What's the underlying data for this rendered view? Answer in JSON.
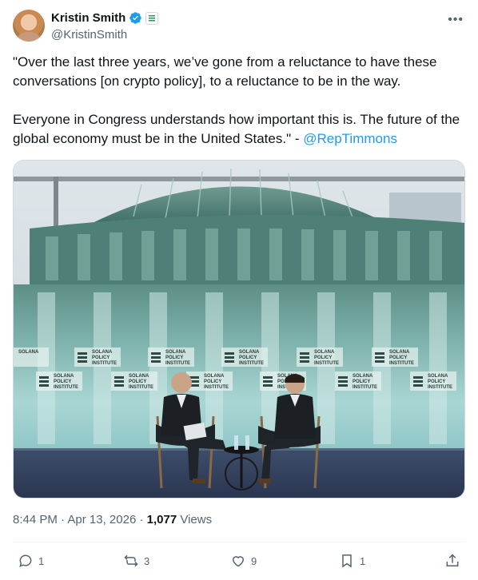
{
  "author": {
    "display_name": "Kristin Smith",
    "handle": "@KristinSmith"
  },
  "tweet": {
    "paragraph_1": "\"Over the last three years, we’ve gone from a reluctance to have these conversations [on crypto policy], to a reluctance to be in the way.",
    "paragraph_2_text": "Everyone in Congress understands how important this is. The future of the global economy must be in the United States.\" - ",
    "mention": "@RepTimmons"
  },
  "media": {
    "backdrop_label_line1": "SOLANA",
    "backdrop_label_line2": "POLICY",
    "backdrop_label_line3": "INSTITUTE"
  },
  "meta": {
    "time": "8:44 PM",
    "separator": " · ",
    "date": "Apr 13, 2026",
    "separator2": " · ",
    "views_count": "1,077",
    "views_label": " Views"
  },
  "actions": {
    "replies": "1",
    "reposts": "3",
    "likes": "9",
    "bookmarks": "1"
  },
  "colors": {
    "accent": "#1d9bf0",
    "text": "#0f1419",
    "muted": "#536471"
  }
}
